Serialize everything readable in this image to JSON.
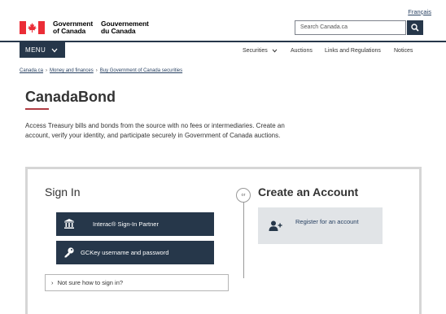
{
  "header": {
    "language_link": "Français",
    "signature_en": [
      "Government",
      "of Canada"
    ],
    "signature_fr": [
      "Gouvernement",
      "du Canada"
    ],
    "search_placeholder": "Search Canada.ca",
    "search_icon": "search-icon"
  },
  "nav": {
    "menu_label": "MENU",
    "items": [
      "Securities",
      "Auctions",
      "Links and Regulations",
      "Notices"
    ]
  },
  "breadcrumb": [
    "Canada.ca",
    "Money and finances",
    "Buy Government of Canada securities"
  ],
  "page": {
    "title": "CanadaBond",
    "intro": "Access Treasury bills and bonds from the source with no fees or intermediaries. Create an account, verify your identity, and participate securely in Government of Canada auctions."
  },
  "signin": {
    "heading": "Sign In",
    "interac_label": "Interac® Sign-In Partner",
    "gckey_label": "GCKey username and password",
    "help_label": "Not sure how to sign in?"
  },
  "divider": {
    "or_label": "or"
  },
  "create": {
    "heading": "Create an Account",
    "register_label": "Register for an account"
  },
  "colors": {
    "brand_dark": "#26374a",
    "accent_red": "#af3c43",
    "flag_red": "#eb2d37",
    "link": "#284162"
  }
}
